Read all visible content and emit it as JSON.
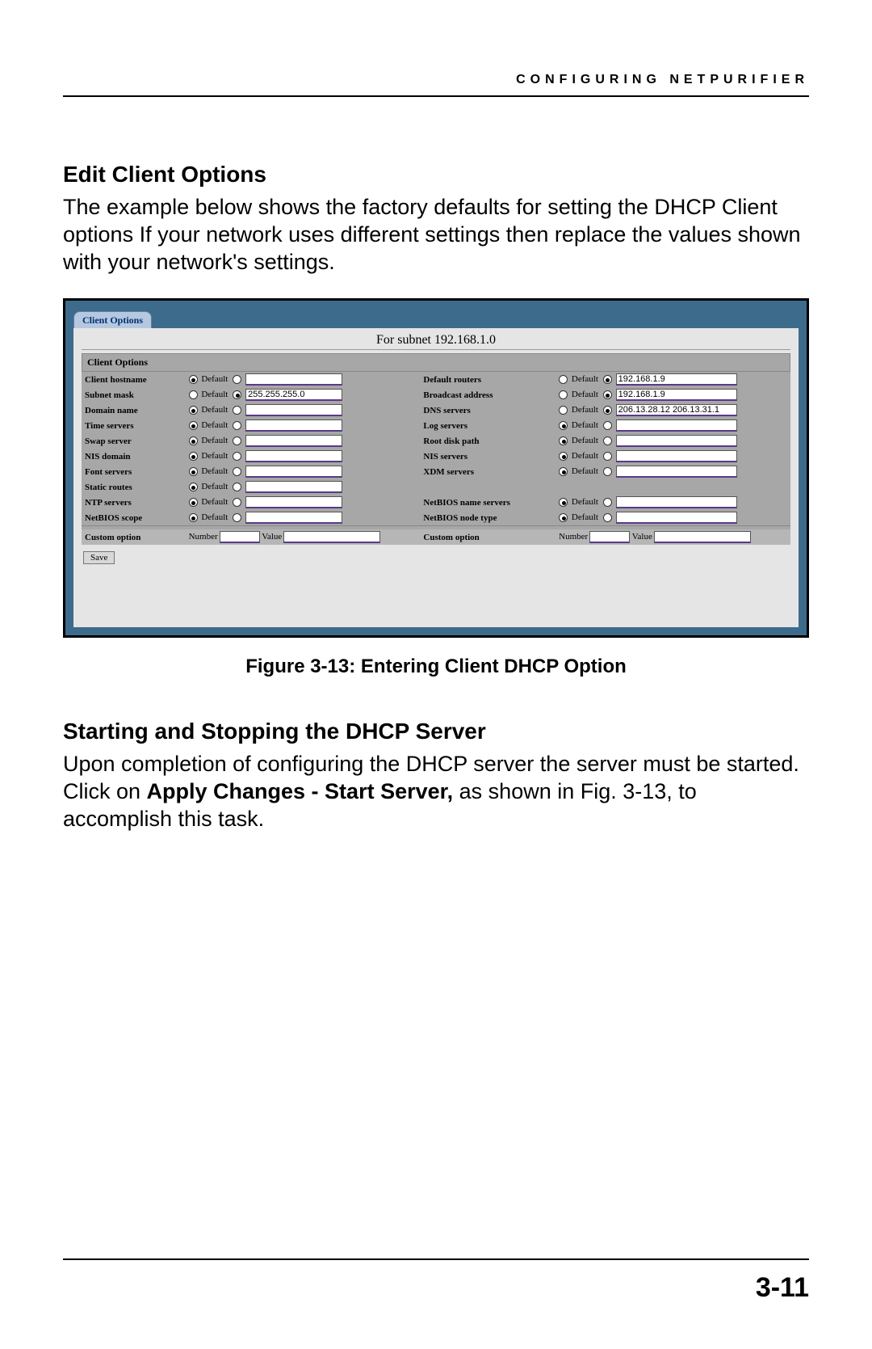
{
  "header": {
    "running": "CONFIGURING NETPURIFIER"
  },
  "sections": {
    "edit_title": "Edit Client Options",
    "edit_para": "The example below shows the factory defaults for setting the DHCP Client options If your network uses different settings then replace the values shown with your network's settings.",
    "start_title": "Starting and Stopping the DHCP Server",
    "start_para_pre": "Upon completion of configuring the DHCP server the server must be started. Click on ",
    "start_para_bold": "Apply Changes - Start Server,",
    "start_para_post": " as shown in Fig. 3-13, to accomplish this task."
  },
  "figure": {
    "caption": "Figure 3-13: Entering Client DHCP Option"
  },
  "page_number": "3-11",
  "shot": {
    "tab": "Client Options",
    "subtitle": "For subnet 192.168.1.0",
    "section_bar": "Client Options",
    "default_label": "Default",
    "save": "Save",
    "left": [
      {
        "label": "Client hostname",
        "sel": "default",
        "val": ""
      },
      {
        "label": "Subnet mask",
        "sel": "value",
        "val": "255.255.255.0"
      },
      {
        "label": "Domain name",
        "sel": "default",
        "val": ""
      },
      {
        "label": "Time servers",
        "sel": "default",
        "val": ""
      },
      {
        "label": "Swap server",
        "sel": "default",
        "val": ""
      },
      {
        "label": "NIS domain",
        "sel": "default",
        "val": ""
      },
      {
        "label": "Font servers",
        "sel": "default",
        "val": ""
      },
      {
        "label": "Static routes",
        "sel": "default",
        "val": ""
      },
      {
        "label": "NTP servers",
        "sel": "default",
        "val": ""
      },
      {
        "label": "NetBIOS scope",
        "sel": "default",
        "val": ""
      }
    ],
    "right": [
      {
        "label": "Default routers",
        "sel": "value",
        "val": "192.168.1.9"
      },
      {
        "label": "Broadcast address",
        "sel": "value",
        "val": "192.168.1.9"
      },
      {
        "label": "DNS servers",
        "sel": "value",
        "val": "206.13.28.12 206.13.31.1"
      },
      {
        "label": "Log servers",
        "sel": "default",
        "val": ""
      },
      {
        "label": "Root disk path",
        "sel": "default",
        "val": ""
      },
      {
        "label": "NIS servers",
        "sel": "default",
        "val": ""
      },
      {
        "label": "XDM servers",
        "sel": "default",
        "val": ""
      },
      {
        "label": "",
        "sel": "",
        "val": ""
      },
      {
        "label": "NetBIOS name servers",
        "sel": "default",
        "val": ""
      },
      {
        "label": "NetBIOS node type",
        "sel": "default",
        "val": ""
      }
    ],
    "custom": {
      "label": "Custom option",
      "number": "Number",
      "value": "Value"
    }
  }
}
